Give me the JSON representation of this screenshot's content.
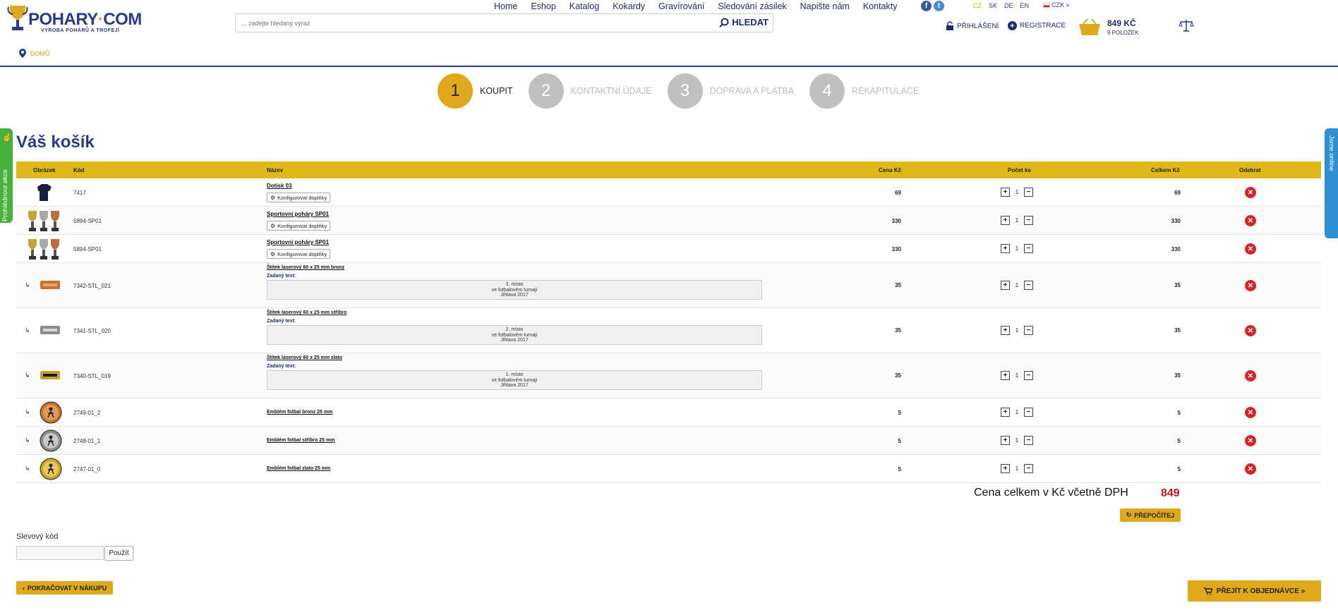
{
  "header": {
    "logo_brand_a": "POHARY",
    "logo_brand_dot": "·",
    "logo_brand_b": "COM",
    "logo_tagline": "VÝROBA POHÁRŮ A TROFEJÍ",
    "nav": [
      "Home",
      "Eshop",
      "Katalog",
      "Kokardy",
      "Gravírování",
      "Sledování zásilek",
      "Napište nám",
      "Kontakty"
    ],
    "languages": [
      "CZ",
      "SK",
      "DE",
      "EN"
    ],
    "active_language": "CZ",
    "currency": "CZK »",
    "search_placeholder": "... zadejte hledaný výraz",
    "search_button": "HLEDAT",
    "login": "PŘIHLÁŠENÍ",
    "register": "REGISTRACE",
    "cart_amount": "849 KČ",
    "cart_count": "9 POLOŽEK"
  },
  "breadcrumb": "DOMŮ",
  "steps": [
    {
      "num": "1",
      "label": "KOUPIT",
      "active": true
    },
    {
      "num": "2",
      "label": "KONTAKTNÍ ÚDAJE",
      "active": false
    },
    {
      "num": "3",
      "label": "DOPRAVA A PLATBA",
      "active": false
    },
    {
      "num": "4",
      "label": "REKAPITULACE",
      "active": false
    }
  ],
  "side_left": "Prohlédnout akce",
  "side_right": "Jsme online",
  "title": "Váš košík",
  "columns": {
    "image": "Obrázek",
    "code": "Kód",
    "name": "Název",
    "price": "Cena Kč",
    "qty": "Počet ks",
    "total": "Celkem Kč",
    "remove": "Odebrat"
  },
  "configure_label": "Konfigurovat doplňky",
  "entered_text_label": "Zadaný text:",
  "items": [
    {
      "code": "7417",
      "name": "Dotisk 03",
      "price": "69",
      "qty": "1",
      "total": "69",
      "configurable": true
    },
    {
      "code": "5894-SP01",
      "name": "Sportovní poháry SP01",
      "price": "330",
      "qty": "1",
      "total": "330",
      "configurable": true
    },
    {
      "code": "5894-SP01",
      "name": "Sportovní poháry SP01",
      "price": "330",
      "qty": "1",
      "total": "330",
      "configurable": true
    },
    {
      "code": "7342-STL_021",
      "name": "Štítek laserový 60 x 25 mm bronz",
      "price": "35",
      "qty": "1",
      "total": "35",
      "text": [
        "3. místo",
        "ve fotbalovém turnaji",
        "Jihlava 2017"
      ]
    },
    {
      "code": "7341-STL_020",
      "name": "Štítek laserový 60 x 25 mm stříbro",
      "price": "35",
      "qty": "1",
      "total": "35",
      "text": [
        "2. místo",
        "ve fotbalovém turnaji",
        "Jihlava 2017"
      ]
    },
    {
      "code": "7340-STL_019",
      "name": "Štítek laserový 60 x 25 mm zlato",
      "price": "35",
      "qty": "1",
      "total": "35",
      "text": [
        "1. místo",
        "ve fotbalovém turnaji",
        "Jihlava 2017"
      ]
    },
    {
      "code": "2749-01_2",
      "name": "Emblém fotbal bronz 25 mm",
      "price": "5",
      "qty": "1",
      "total": "5"
    },
    {
      "code": "2748-01_1",
      "name": "Emblém fotbal stříbro 25 mm",
      "price": "5",
      "qty": "1",
      "total": "5"
    },
    {
      "code": "2747-01_0",
      "name": "Emblém fotbal zlato 25 mm",
      "price": "5",
      "qty": "1",
      "total": "5"
    }
  ],
  "sum_label": "Cena celkem v Kč včetně DPH",
  "sum_value": "849",
  "recalculate": "PŘEPOČÍTEJ",
  "discount_label": "Slevový kód",
  "discount_apply": "Použít",
  "continue_shopping": "POKRAČOVAT V NÁKUPU",
  "proceed": "PŘEJÍT K OBJEDNÁVCE »",
  "colors": {
    "accent": "#e0a91c",
    "brand": "#2b3a8c",
    "danger": "#d6242a",
    "sum": "#c4161c"
  }
}
